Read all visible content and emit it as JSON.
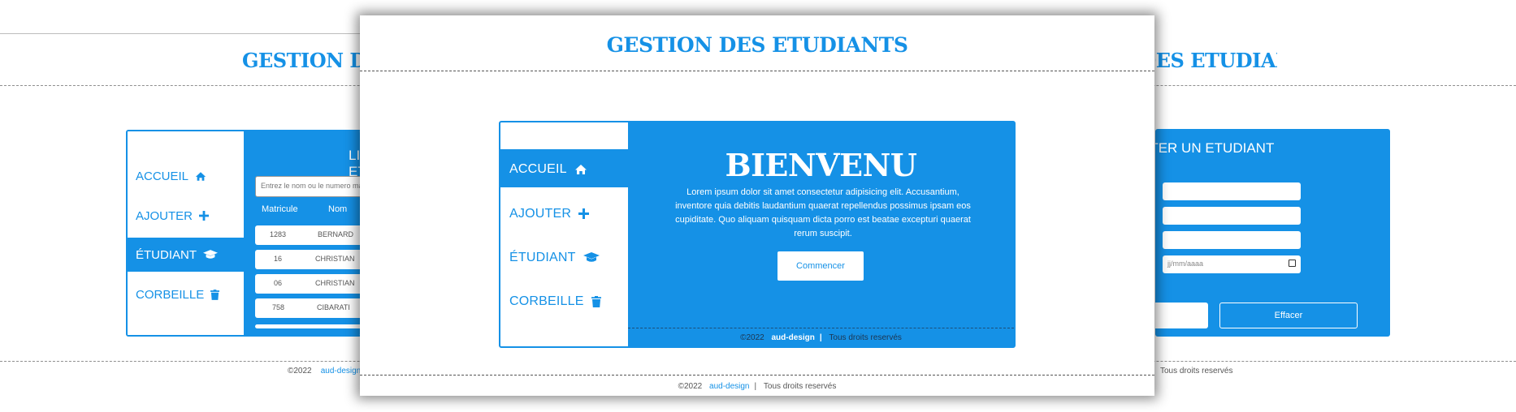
{
  "app": {
    "title": "GESTION DES ETUDIANTS",
    "bg_title_left": "GESTION DES ETUDIANTS",
    "bg_title_right": "GESTION DES ETUDIANTS"
  },
  "nav": {
    "items": [
      {
        "label": "ACCUEIL",
        "icon": "home-icon"
      },
      {
        "label": "AJOUTER",
        "icon": "plus-icon"
      },
      {
        "label": "ÉTUDIANT",
        "icon": "graduation-cap-icon"
      },
      {
        "label": "CORBEILLE",
        "icon": "trash-icon"
      }
    ]
  },
  "welcome": {
    "title": "BIENVENU",
    "text": "Lorem ipsum dolor sit amet consectetur adipisicing elit. Accusantium, inventore quia debitis laudantium quaerat repellendus possimus ipsam eos cupiditate. Quo aliquam quisquam dicta porro est beatae excepturi quaerat rerum suscipit.",
    "button": "Commencer"
  },
  "footer": {
    "copyright": "©2022",
    "brand": "aud-design",
    "separator": "|",
    "rights": "Tous droits reservés"
  },
  "list_view": {
    "title": "LISTE DES ETUDIANTS",
    "search_placeholder": "Entrez le nom ou le numero matricule",
    "columns": [
      "Matricule",
      "Nom"
    ],
    "rows": [
      {
        "matricule": "1283",
        "nom": "BERNARD"
      },
      {
        "matricule": "16",
        "nom": "CHRISTIAN"
      },
      {
        "matricule": "06",
        "nom": "CHRISTIAN"
      },
      {
        "matricule": "758",
        "nom": "CIBARATI"
      }
    ]
  },
  "add_form": {
    "title": "AJOUTER UN ETUDIANT",
    "date_placeholder": "jj/mm/aaaa",
    "clear_button": "Effacer"
  },
  "colors": {
    "accent": "#1591e6",
    "background": "#ffffff",
    "text_muted": "#555555"
  }
}
